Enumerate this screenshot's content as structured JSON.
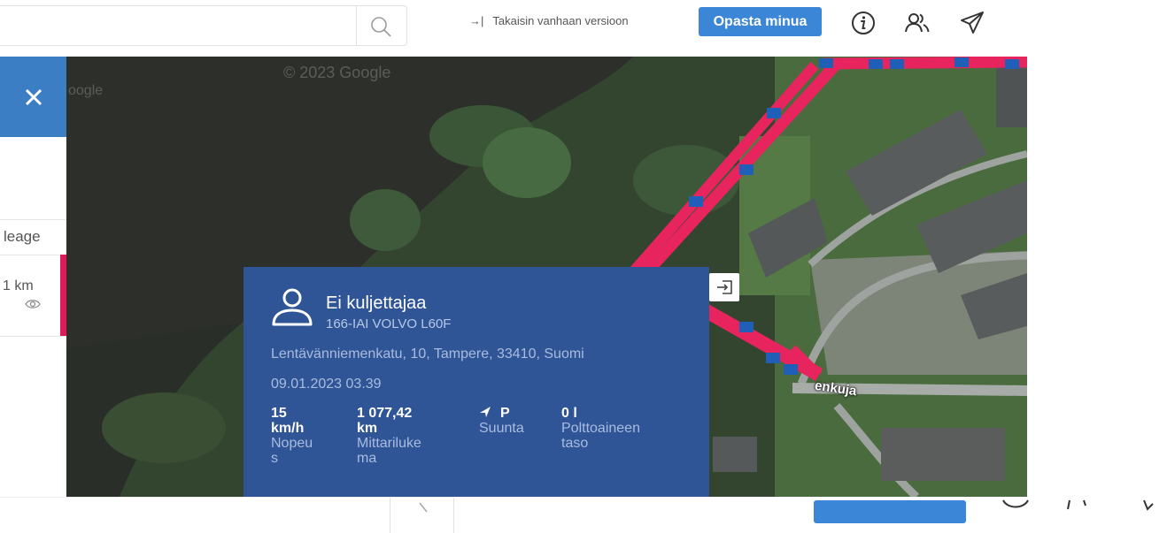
{
  "header": {
    "search_placeholder": "",
    "back_link_label": "Takaisin vanhaan versioon",
    "guide_button_label": "Opasta minua",
    "icons": [
      "search-icon",
      "info-icon",
      "users-icon",
      "send-icon"
    ]
  },
  "left_panel": {
    "column_label": "leage",
    "cell_value": "1 km"
  },
  "map": {
    "copyright": "© 2023 Google",
    "attribution_fragment": "oogle",
    "street_label": "enkuja"
  },
  "vehicle_popup": {
    "driver": "Ei kuljettajaa",
    "vehicle": "166-IAI VOLVO L60F",
    "address": "Lentävänniemenkatu, 10, Tampere, 33410, Suomi",
    "timestamp": "09.01.2023 03.39",
    "stats": [
      {
        "value": "15\nkm/h",
        "label": "Nopeu\ns"
      },
      {
        "value": "1 077,42\nkm",
        "label": "Mittariluke\nma"
      },
      {
        "value": "P",
        "label": "Suunta"
      },
      {
        "value": "0 l",
        "label": "Polttoaineen\ntaso"
      }
    ]
  },
  "colors": {
    "accent_blue": "#3b86d6",
    "panel_blue": "#3c7ec4",
    "popup_blue": "#2f5597",
    "route_pink": "#e8245f",
    "marker_red": "#e0195b"
  }
}
